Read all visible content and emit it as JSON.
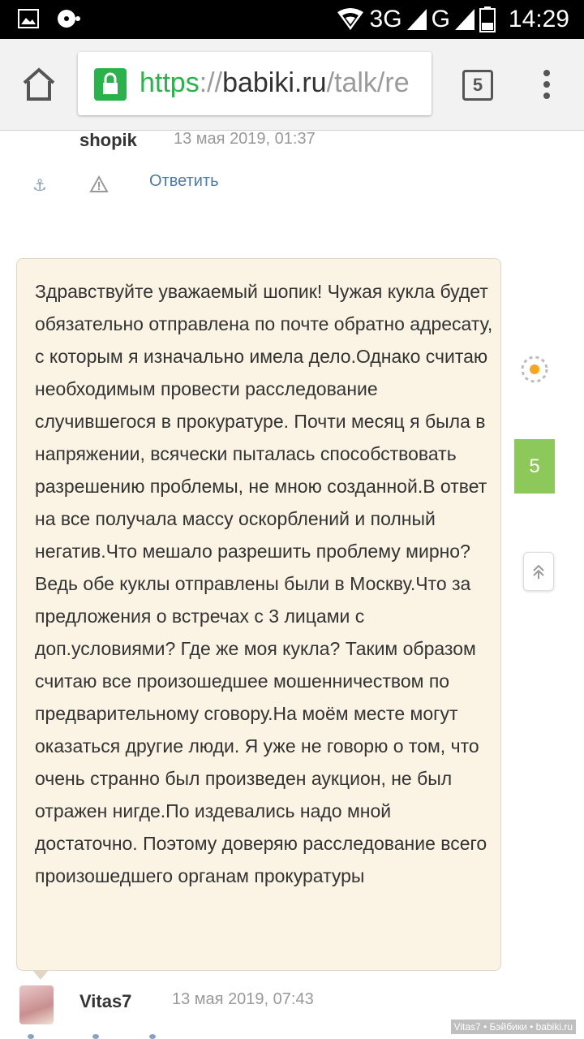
{
  "status_bar": {
    "network": "3G",
    "network2": "G",
    "time": "14:29"
  },
  "browser": {
    "url_scheme": "https",
    "url_sep": "://",
    "url_host": "babiki.ru",
    "url_path": "/talk/re",
    "tab_count": "5"
  },
  "comment_header": {
    "author": "shopik",
    "date": "13 мая 2019, 01:37",
    "reply_label": "Ответить"
  },
  "post": {
    "text": "Здравствуйте уважаемый шопик! Чужая кукла будет обязательно отправлена по почте обратно адресату, с которым я изначально имела дело.Однако считаю необходимым провести расследование случившегося в прокуратуре. Почти месяц я была в напряжении, всячески пыталась способствовать разрешению проблемы, не мною созданной.В ответ на все получала массу оскорблений и полный негатив.Что мешало разрешить проблему мирно? Ведь обе куклы отправлены были в Москву.Что за предложения о встречах с 3 лицами с доп.условиями? Где же моя кукла? Таким образом считаю все произошедшее мошенничеством по предварительному сговору.На моём месте могут оказаться другие люди. Я уже не говорю о том, что очень странно был произведен аукцион, не был отражен нигде.По издевались надо мной достаточно. Поэтому доверяю расследование всего произошедшего органам прокуратуры"
  },
  "sidebar": {
    "count": "5"
  },
  "next_comment": {
    "author": "Vitas7",
    "date": "13 мая 2019, 07:43"
  },
  "watermark": "Vitas7 • Бэйбики • babiki.ru",
  "colors": {
    "accent_green": "#8cc85a",
    "bubble_bg": "#fbf3e4",
    "link": "#4a7ab0"
  }
}
